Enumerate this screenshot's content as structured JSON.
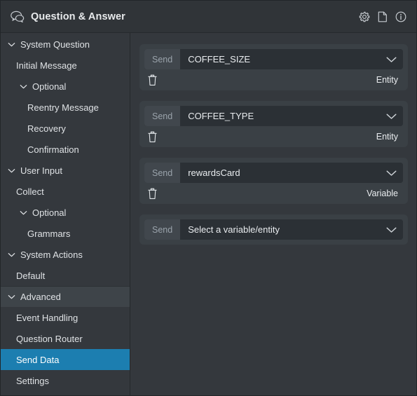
{
  "header": {
    "title": "Question & Answer",
    "icon": "chat-bubbles-icon",
    "actions": [
      {
        "name": "settings-gear-icon",
        "label": "Settings"
      },
      {
        "name": "document-icon",
        "label": "Document"
      },
      {
        "name": "info-icon",
        "label": "Info"
      }
    ]
  },
  "sidebar": {
    "items": [
      {
        "label": "System Question",
        "level": 0,
        "expandable": true,
        "state": "group",
        "name": "sidebar-item-system-question"
      },
      {
        "label": "Initial Message",
        "level": 1,
        "expandable": false,
        "state": "normal",
        "name": "sidebar-item-initial-message"
      },
      {
        "label": "Optional",
        "level": 2,
        "expandable": true,
        "state": "normal",
        "name": "sidebar-item-optional-system-question"
      },
      {
        "label": "Reentry Message",
        "level": 3,
        "expandable": false,
        "state": "normal",
        "name": "sidebar-item-reentry-message"
      },
      {
        "label": "Recovery",
        "level": 3,
        "expandable": false,
        "state": "normal",
        "name": "sidebar-item-recovery"
      },
      {
        "label": "Confirmation",
        "level": 3,
        "expandable": false,
        "state": "normal",
        "name": "sidebar-item-confirmation"
      },
      {
        "label": "User Input",
        "level": 0,
        "expandable": true,
        "state": "group",
        "name": "sidebar-item-user-input"
      },
      {
        "label": "Collect",
        "level": 1,
        "expandable": false,
        "state": "normal",
        "name": "sidebar-item-collect"
      },
      {
        "label": "Optional",
        "level": 2,
        "expandable": true,
        "state": "normal",
        "name": "sidebar-item-optional-user-input"
      },
      {
        "label": "Grammars",
        "level": 3,
        "expandable": false,
        "state": "normal",
        "name": "sidebar-item-grammars"
      },
      {
        "label": "System Actions",
        "level": 0,
        "expandable": true,
        "state": "group",
        "name": "sidebar-item-system-actions"
      },
      {
        "label": "Default",
        "level": 1,
        "expandable": false,
        "state": "normal",
        "name": "sidebar-item-default"
      },
      {
        "label": "Advanced",
        "level": 0,
        "expandable": true,
        "state": "group-hl",
        "name": "sidebar-item-advanced"
      },
      {
        "label": "Event Handling",
        "level": 1,
        "expandable": false,
        "state": "normal",
        "name": "sidebar-item-event-handling"
      },
      {
        "label": "Question Router",
        "level": 1,
        "expandable": false,
        "state": "normal",
        "name": "sidebar-item-question-router"
      },
      {
        "label": "Send Data",
        "level": 1,
        "expandable": false,
        "state": "selected",
        "name": "sidebar-item-send-data"
      },
      {
        "label": "Settings",
        "level": 1,
        "expandable": false,
        "state": "normal",
        "name": "sidebar-item-settings"
      }
    ]
  },
  "main": {
    "send_label": "Send",
    "placeholder": "Select a variable/entity",
    "rows": [
      {
        "prefix": "Send",
        "value": "COFFEE_SIZE",
        "type": "Entity",
        "has_footer": true,
        "name": "send-data-row-coffee-size"
      },
      {
        "prefix": "Send",
        "value": "COFFEE_TYPE",
        "type": "Entity",
        "has_footer": true,
        "name": "send-data-row-coffee-type"
      },
      {
        "prefix": "Send",
        "value": "rewardsCard",
        "type": "Variable",
        "has_footer": true,
        "name": "send-data-row-rewards-card"
      },
      {
        "prefix": "Send",
        "value": "Select a variable/entity",
        "type": "",
        "has_footer": false,
        "name": "send-data-row-empty"
      }
    ]
  },
  "colors": {
    "accent": "#1c7eb0",
    "panel_bg": "#34383d",
    "card_bg": "#3a4045",
    "field_bg": "#2b3035",
    "prefix_bg": "#41474d",
    "header_bg": "#303438",
    "text": "#e9ecef",
    "muted_text": "#9aa3ab"
  }
}
